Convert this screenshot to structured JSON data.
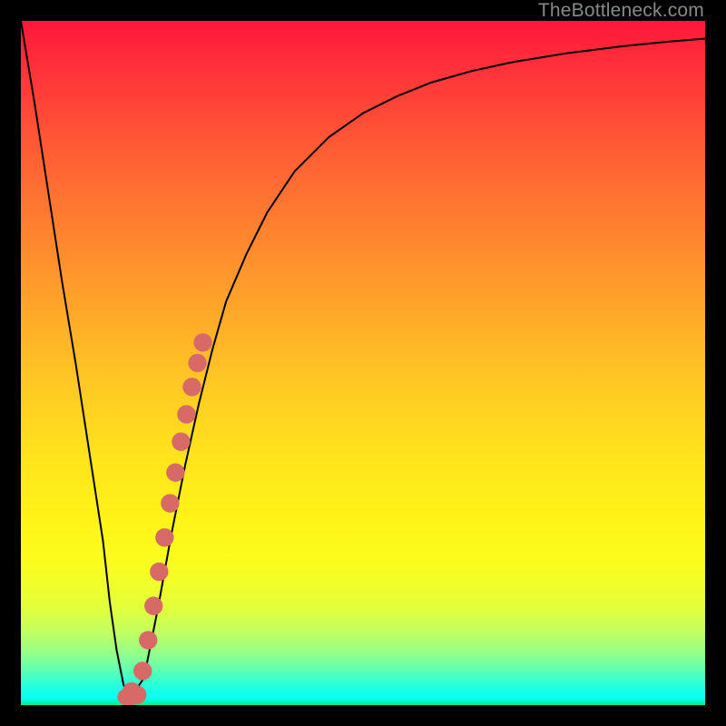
{
  "watermark": "TheBottleneck.com",
  "chart_data": {
    "type": "line",
    "title": "",
    "xlabel": "",
    "ylabel": "",
    "xlim": [
      0,
      100
    ],
    "ylim": [
      0,
      100
    ],
    "series": [
      {
        "name": "bottleneck-curve",
        "x": [
          0,
          2,
          4,
          6,
          8,
          10,
          12,
          13,
          14,
          15,
          16,
          18,
          20,
          22,
          24,
          26,
          28,
          30,
          33,
          36,
          40,
          45,
          50,
          55,
          60,
          66,
          72,
          80,
          88,
          95,
          100
        ],
        "y": [
          100,
          88,
          75,
          62,
          50,
          37,
          24,
          15,
          8,
          3,
          1,
          4,
          14,
          25,
          35,
          44,
          52,
          59,
          66,
          72,
          78,
          83,
          86.5,
          89,
          91,
          92.7,
          94,
          95.3,
          96.3,
          97,
          97.4
        ]
      },
      {
        "name": "highlight-segment",
        "x": [
          16.2,
          17.0,
          17.8,
          18.6,
          19.4,
          20.2,
          21.0,
          21.8,
          22.6,
          23.4,
          24.2,
          25.0,
          25.8,
          26.6
        ],
        "y": [
          2.0,
          1.5,
          5.0,
          9.5,
          14.5,
          19.5,
          24.5,
          29.5,
          34.0,
          38.5,
          42.5,
          46.5,
          50.0,
          53.0
        ]
      }
    ],
    "highlight_color": "#d76a66",
    "curve_color": "#000000"
  }
}
